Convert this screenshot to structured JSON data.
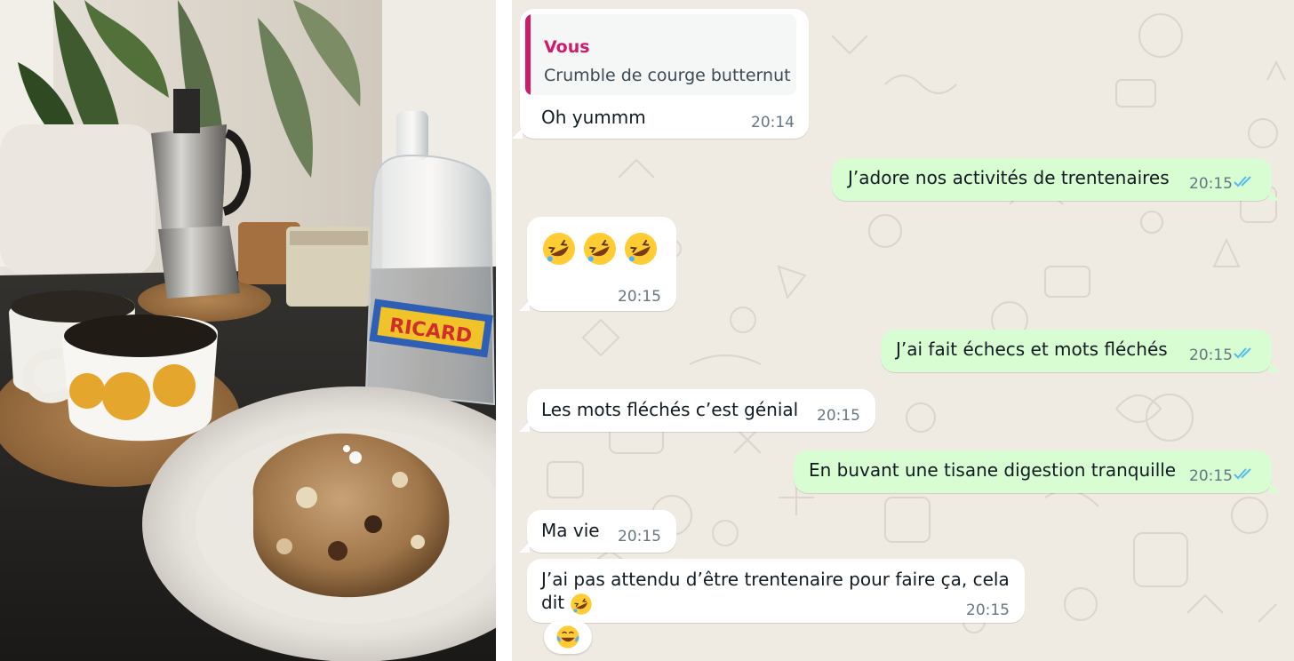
{
  "photo": {
    "label_text": "RICARD"
  },
  "chat": {
    "messages": [
      {
        "id": "m1",
        "direction": "incoming",
        "quote_author": "Vous",
        "quote_text": "Crumble de courge butternut",
        "text": "Oh yummm",
        "time": "20:14"
      },
      {
        "id": "m2",
        "direction": "outgoing",
        "text": "J’adore nos activités de trentenaires",
        "time": "20:15",
        "status": "read"
      },
      {
        "id": "m3",
        "direction": "incoming",
        "emojis": [
          "rolling-on-floor-laughing",
          "rolling-on-floor-laughing",
          "rolling-on-floor-laughing"
        ],
        "time": "20:15"
      },
      {
        "id": "m4",
        "direction": "outgoing",
        "text": "J’ai fait échecs et mots fléchés",
        "time": "20:15",
        "status": "read"
      },
      {
        "id": "m5",
        "direction": "incoming",
        "text": "Les mots fléchés c’est génial",
        "time": "20:15"
      },
      {
        "id": "m6",
        "direction": "outgoing",
        "text": "En buvant une tisane digestion tranquille",
        "time": "20:15",
        "status": "read"
      },
      {
        "id": "m7",
        "direction": "incoming",
        "text": "Ma vie",
        "time": "20:15"
      },
      {
        "id": "m8",
        "direction": "incoming",
        "line1": "J’ai pas attendu d’être trentenaire pour faire ça, cela",
        "line2": "dit",
        "emoji": "rolling-on-floor-laughing",
        "time": "20:15",
        "reaction": "face-with-tears-of-joy"
      }
    ]
  },
  "colors": {
    "chat_background": "#efeae2",
    "incoming_bubble": "#ffffff",
    "outgoing_bubble": "#d9fdd3",
    "quote_accent": "#d11a6a",
    "read_ticks": "#53bdeb",
    "timestamp": "#667781"
  }
}
